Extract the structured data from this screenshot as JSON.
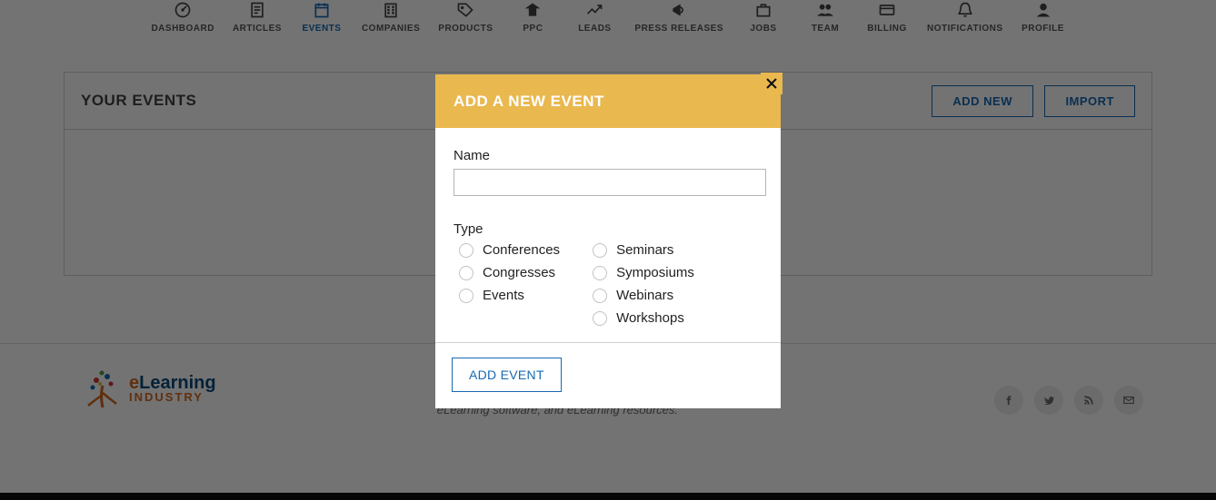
{
  "nav": [
    {
      "id": "dashboard",
      "label": "DASHBOARD"
    },
    {
      "id": "articles",
      "label": "ARTICLES"
    },
    {
      "id": "events",
      "label": "EVENTS",
      "active": true
    },
    {
      "id": "companies",
      "label": "COMPANIES"
    },
    {
      "id": "products",
      "label": "PRODUCTS"
    },
    {
      "id": "ppc",
      "label": "PPC"
    },
    {
      "id": "leads",
      "label": "LEADS"
    },
    {
      "id": "press-releases",
      "label": "PRESS RELEASES"
    },
    {
      "id": "jobs",
      "label": "JOBS"
    },
    {
      "id": "team",
      "label": "TEAM"
    },
    {
      "id": "billing",
      "label": "BILLING"
    },
    {
      "id": "notifications",
      "label": "NOTIFICATIONS"
    },
    {
      "id": "profile",
      "label": "PROFILE"
    }
  ],
  "content": {
    "title": "YOUR EVENTS",
    "add_new_label": "ADD NEW",
    "import_label": "IMPORT"
  },
  "footer": {
    "logo_line_1a": "e",
    "logo_line_1b": "Learning",
    "logo_line_2": "INDUSTRY",
    "tagline": "The best collection of eLearning articles, eLearning concepts, eLearning software, and eLearning resources."
  },
  "modal": {
    "title": "ADD A NEW EVENT",
    "name_label": "Name",
    "name_value": "",
    "type_label": "Type",
    "type_options_col1": [
      "Conferences",
      "Congresses",
      "Events"
    ],
    "type_options_col2": [
      "Seminars",
      "Symposiums",
      "Webinars",
      "Workshops"
    ],
    "submit_label": "ADD EVENT"
  },
  "colors": {
    "accent_blue": "#1769b3",
    "modal_header": "#e9b84f",
    "overlay": "rgba(0,0,0,0.55)"
  }
}
